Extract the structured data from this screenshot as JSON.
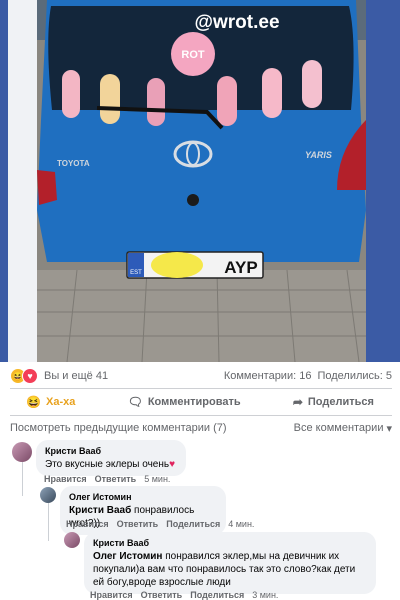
{
  "photo": {
    "watermark": "@wrot.ee",
    "badge": "ROT",
    "brand_left": "TOYOTA",
    "brand_right": "YARIS",
    "plate_country": "EST",
    "plate_text": "AYP"
  },
  "reactions": {
    "summary": "Вы и ещё 41"
  },
  "stats": {
    "comments": "Комментарии: 16",
    "shares": "Поделились: 5"
  },
  "actions": [
    {
      "label": "Ха-ха",
      "icon": "haha-icon"
    },
    {
      "label": "Комментировать",
      "icon": "comment-icon"
    },
    {
      "label": "Поделиться",
      "icon": "share-icon"
    }
  ],
  "comments_bar": {
    "previous": "Посмотреть предыдущие комментарии (7)",
    "filter": "Все комментарии"
  },
  "comments": [
    {
      "author": "Кристи Вааб",
      "text": "Это вкусные эклеры очень",
      "like": "Нравится",
      "reply": "Ответить",
      "time": "5 мин."
    },
    {
      "author": "Олег Истомин",
      "mention": "Кристи Вааб",
      "text": "понравилось wrot?))",
      "like": "Нравится",
      "reply": "Ответить",
      "share": "Поделиться",
      "time": "4 мин."
    },
    {
      "author": "Кристи Вааб",
      "mention": "Олег Истомин",
      "text": "понравился эклер,мы на девичник их покупали)а вам что понравилось так это слово?как дети ей богу,вроде взрослые люди",
      "like": "Нравится",
      "reply": "Ответить",
      "share": "Поделиться",
      "time": "3 мин."
    }
  ],
  "colors": {
    "accent": "#e8a21f",
    "car": "#1f6fc0",
    "frame": "#3b5ba5"
  }
}
